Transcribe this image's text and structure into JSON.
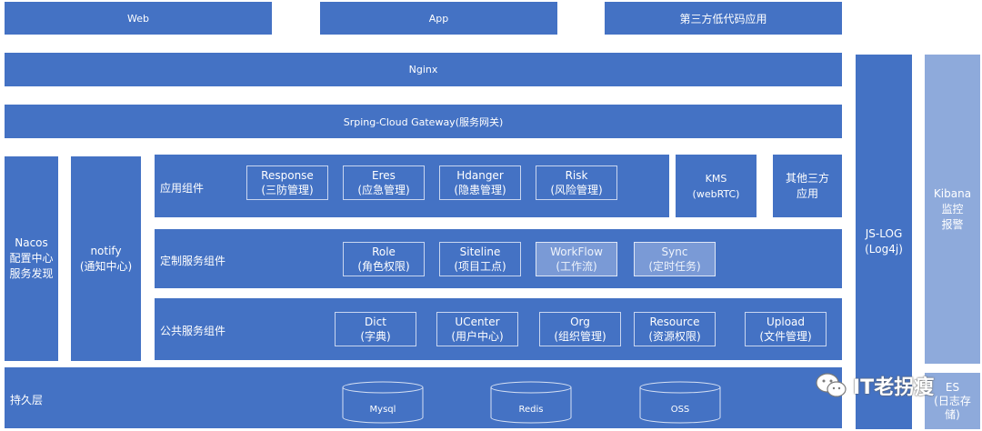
{
  "top_row": {
    "web": "Web",
    "app": "App",
    "third": "第三方低代码应用"
  },
  "nginx": "Nginx",
  "gateway": "Srping-Cloud Gateway(服务网关)",
  "nacos": [
    "Nacos",
    "配置中心",
    "服务发现"
  ],
  "notify": [
    "notify",
    "(通知中心)"
  ],
  "app_components": {
    "label": "应用组件",
    "items": [
      {
        "name": "Response",
        "cn": "(三防管理)"
      },
      {
        "name": "Eres",
        "cn": "(应急管理)"
      },
      {
        "name": "Hdanger",
        "cn": "(隐患管理)"
      },
      {
        "name": "Risk",
        "cn": "(风险管理)"
      }
    ]
  },
  "kms": [
    "KMS",
    "(webRTC)"
  ],
  "other_third": [
    "其他三方",
    "应用"
  ],
  "custom_services": {
    "label": "定制服务组件",
    "items": [
      {
        "name": "Role",
        "cn": "(角色权限)"
      },
      {
        "name": "Siteline",
        "cn": "(项目工点)"
      },
      {
        "name": "WorkFlow",
        "cn": "(工作流)"
      },
      {
        "name": "Sync",
        "cn": "(定时任务)"
      }
    ]
  },
  "public_services": {
    "label": "公共服务组件",
    "items": [
      {
        "name": "Dict",
        "cn": "(字典)"
      },
      {
        "name": "UCenter",
        "cn": "(用户中心)"
      },
      {
        "name": "Org",
        "cn": "(组织管理)"
      },
      {
        "name": "Resource",
        "cn": "(资源权限)"
      },
      {
        "name": "Upload",
        "cn": "(文件管理)"
      }
    ]
  },
  "persistence": {
    "label": "持久层",
    "stores": [
      "Mysql",
      "Redis",
      "OSS"
    ]
  },
  "jslog": [
    "JS-LOG",
    "(Log4j)"
  ],
  "kibana": [
    "Kibana",
    "监控",
    "报警"
  ],
  "es": [
    "ES",
    "(日志存",
    "储)"
  ],
  "watermark": "IT老拐瘦"
}
